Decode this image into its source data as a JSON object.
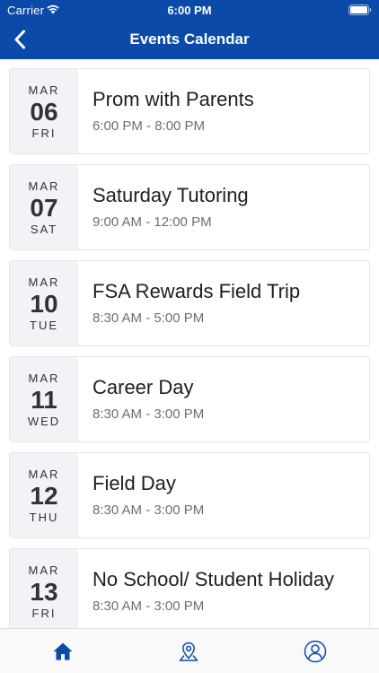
{
  "status_bar": {
    "carrier": "Carrier",
    "time": "6:00 PM"
  },
  "nav": {
    "title": "Events Calendar",
    "back_icon": "chevron-left-icon"
  },
  "events": [
    {
      "month": "MAR",
      "day": "06",
      "weekday": "FRI",
      "title": "Prom with Parents",
      "time": "6:00 PM - 8:00 PM"
    },
    {
      "month": "MAR",
      "day": "07",
      "weekday": "SAT",
      "title": "Saturday Tutoring",
      "time": "9:00 AM - 12:00 PM"
    },
    {
      "month": "MAR",
      "day": "10",
      "weekday": "TUE",
      "title": "FSA Rewards Field Trip",
      "time": "8:30 AM - 5:00 PM"
    },
    {
      "month": "MAR",
      "day": "11",
      "weekday": "WED",
      "title": "Career Day",
      "time": "8:30 AM - 3:00 PM"
    },
    {
      "month": "MAR",
      "day": "12",
      "weekday": "THU",
      "title": "Field Day",
      "time": "8:30 AM - 3:00 PM"
    },
    {
      "month": "MAR",
      "day": "13",
      "weekday": "FRI",
      "title": "No School/ Student Holiday",
      "time": "8:30 AM - 3:00 PM"
    }
  ],
  "tab_bar": {
    "items": [
      {
        "icon": "home-icon",
        "active": true
      },
      {
        "icon": "map-pin-icon",
        "active": false
      },
      {
        "icon": "profile-icon",
        "active": false
      }
    ]
  },
  "colors": {
    "header_bg": "#0b4aa8",
    "date_block_bg": "#f1f3f6",
    "tab_active": "#0b4aa8",
    "tab_inactive": "#0b4aa8"
  }
}
